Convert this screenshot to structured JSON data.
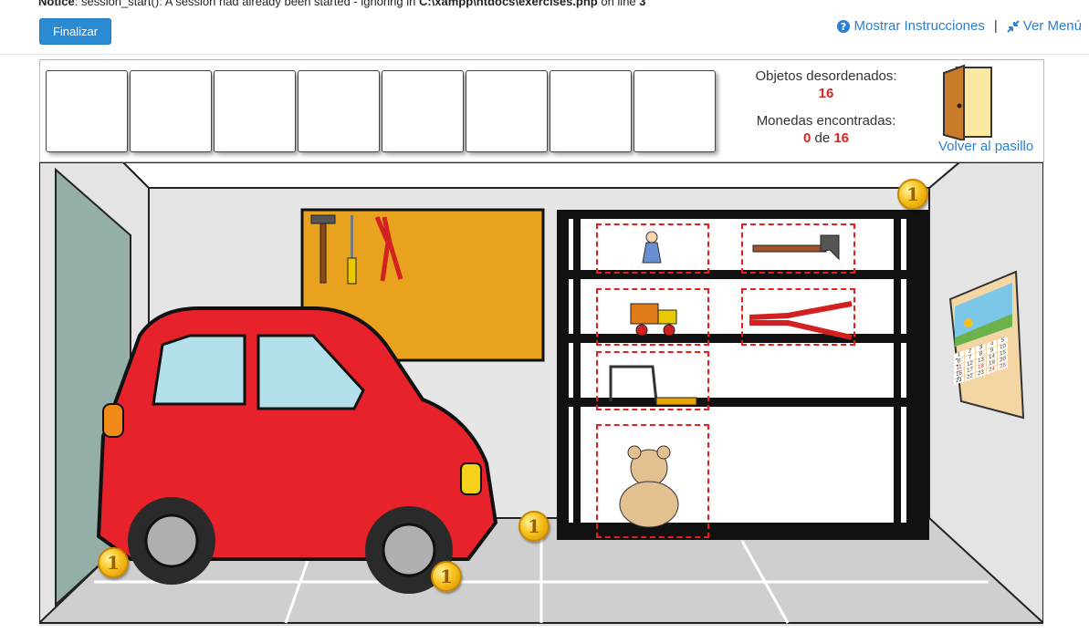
{
  "notice": {
    "label": "Notice",
    "text": ": session_start(): A session had already been started - ignoring in ",
    "file": "C:\\xampp\\htdocs\\exercises.php",
    "mid": " on line ",
    "line": "3"
  },
  "toolbar": {
    "finalizar_label": "Finalizar",
    "instructions_label": "Mostrar Instrucciones",
    "separator": "|",
    "menu_label": "Ver Menú"
  },
  "inventory": {
    "slots": [
      "",
      "",
      "",
      "",
      "",
      "",
      "",
      ""
    ]
  },
  "stats": {
    "disordered_label": "Objetos desordenados:",
    "disordered_value": "16",
    "coins_label": "Monedas encontradas:",
    "coins_found": "0",
    "coins_of": "de",
    "coins_total": "16"
  },
  "door": {
    "label": "Volver al pasillo"
  },
  "scene": {
    "coins": [
      "1",
      "1",
      "1",
      "1"
    ],
    "colors": {
      "accent": "#2a8bd3",
      "link": "#2a7fd4",
      "highlight": "#e61e1e",
      "car": "#e8222a",
      "corkboard": "#e8a21e"
    },
    "calendar_days": [
      "1",
      "2",
      "3",
      "4",
      "5",
      "6",
      "7",
      "8",
      "9",
      "10",
      "11",
      "12",
      "13",
      "14",
      "15",
      "16",
      "17",
      "18",
      "19",
      "20",
      "21",
      "22",
      "23",
      "24",
      "25"
    ]
  }
}
